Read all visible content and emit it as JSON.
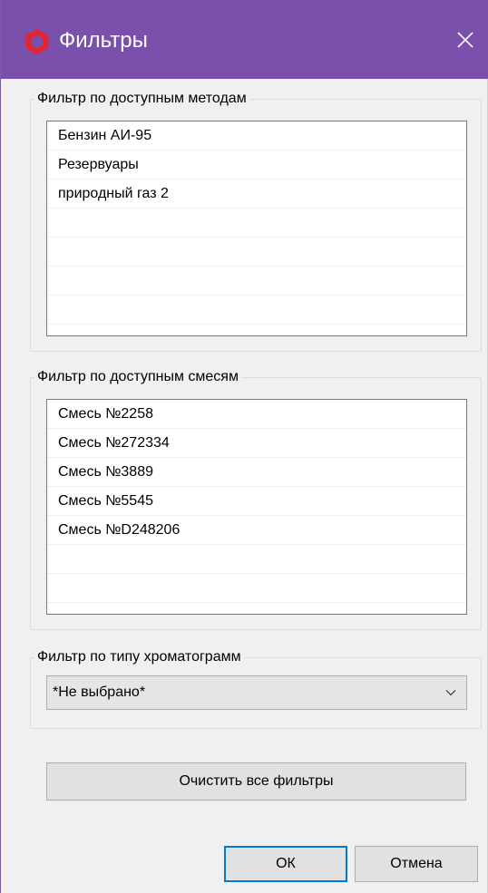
{
  "window": {
    "title": "Фильтры",
    "accent": "#7b4fac",
    "icon": "hexagon-ring-icon",
    "icon_color": "#e5242b"
  },
  "methods_filter": {
    "label": "Фильтр по доступным методам",
    "items": [
      "Бензин АИ-95",
      "Резервуары",
      "природный газ 2",
      "",
      "",
      "",
      "",
      ""
    ]
  },
  "mixtures_filter": {
    "label": "Фильтр по доступным смесям",
    "items": [
      "Смесь №2258",
      "Смесь №272334",
      "Смесь №3889",
      "Смесь №5545",
      "Смесь №D248206",
      "",
      "",
      ""
    ]
  },
  "chromatogram_filter": {
    "label": "Фильтр по типу хроматограмм",
    "selected": "*Не выбрано*"
  },
  "buttons": {
    "clear_all": "Очистить все фильтры",
    "ok": "ОК",
    "cancel": "Отмена"
  }
}
